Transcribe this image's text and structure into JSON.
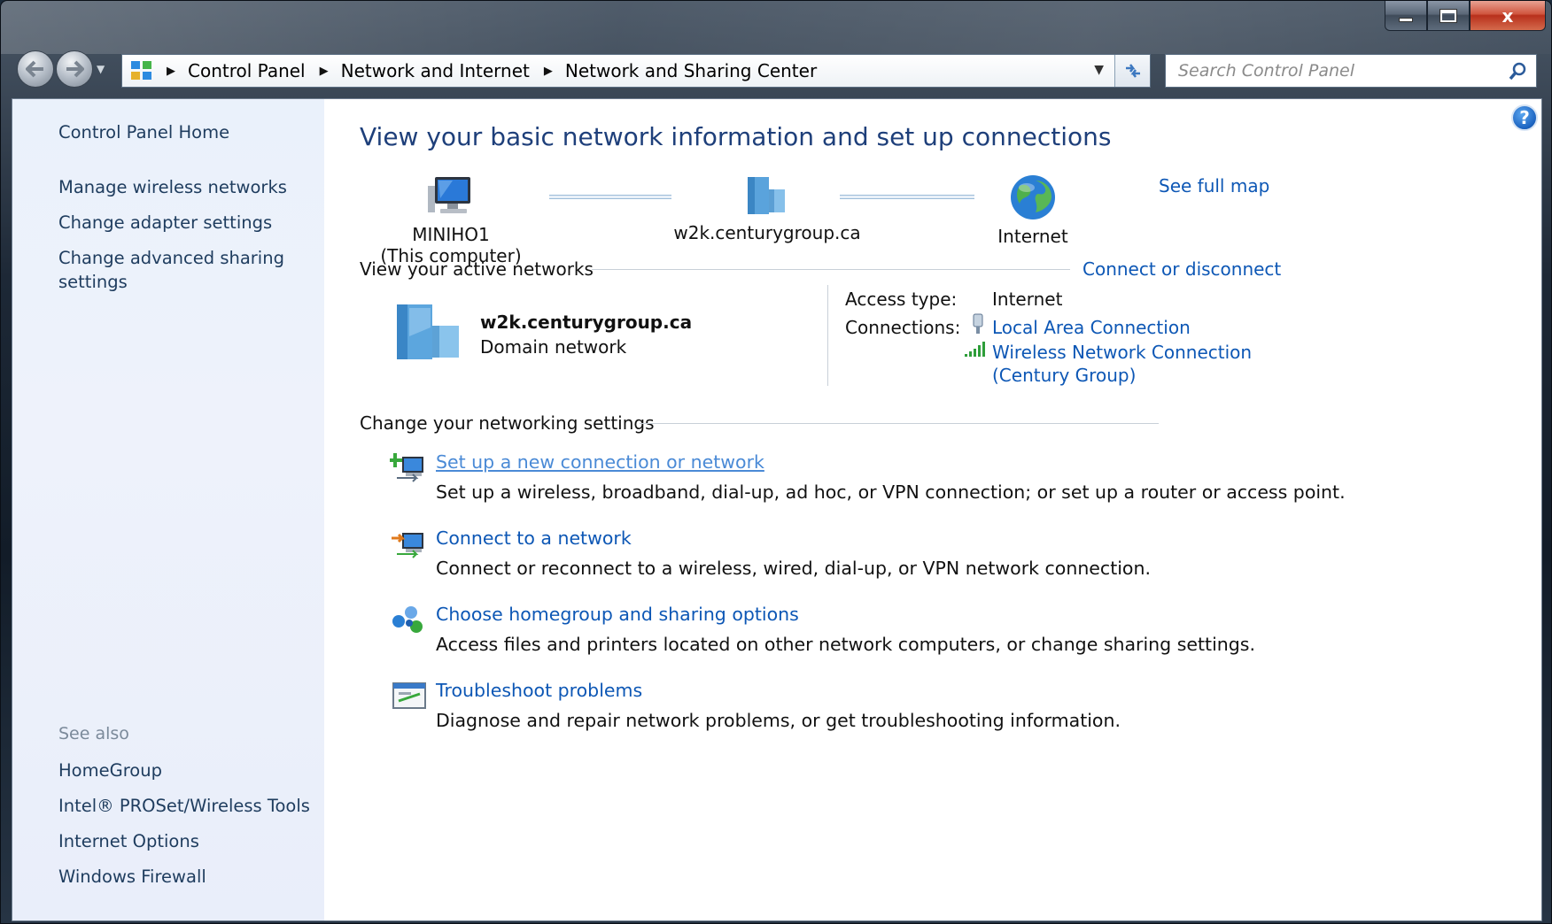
{
  "window": {
    "caption_close_glyph": "x"
  },
  "address_bar": {
    "crumbs": [
      "Control Panel",
      "Network and Internet",
      "Network and Sharing Center"
    ]
  },
  "search": {
    "placeholder": "Search Control Panel"
  },
  "sidebar": {
    "home": "Control Panel Home",
    "tasks": [
      "Manage wireless networks",
      "Change adapter settings",
      "Change advanced sharing settings"
    ],
    "see_also_heading": "See also",
    "see_also": [
      "HomeGroup",
      "Intel® PROSet/Wireless Tools",
      "Internet Options",
      "Windows Firewall"
    ]
  },
  "main": {
    "title": "View your basic network information and set up connections",
    "see_full_map": "See full map",
    "map": {
      "computer_name": "MINIHO1",
      "computer_sub": "(This computer)",
      "domain": "w2k.centurygroup.ca",
      "internet": "Internet"
    },
    "active_networks": {
      "heading": "View your active networks",
      "connect_link": "Connect or disconnect",
      "network_name": "w2k.centurygroup.ca",
      "network_type": "Domain network",
      "access_type_label": "Access type:",
      "access_type_value": "Internet",
      "connections_label": "Connections:",
      "connection_lan": "Local Area Connection",
      "connection_wifi_line1": "Wireless Network Connection",
      "connection_wifi_line2": "(Century Group)"
    },
    "change_settings": {
      "heading": "Change your networking settings",
      "tasks": [
        {
          "title": "Set up a new connection or network",
          "desc": "Set up a wireless, broadband, dial-up, ad hoc, or VPN connection; or set up a router or access point."
        },
        {
          "title": "Connect to a network",
          "desc": "Connect or reconnect to a wireless, wired, dial-up, or VPN network connection."
        },
        {
          "title": "Choose homegroup and sharing options",
          "desc": "Access files and printers located on other network computers, or change sharing settings."
        },
        {
          "title": "Troubleshoot problems",
          "desc": "Diagnose and repair network problems, or get troubleshooting information."
        }
      ]
    }
  },
  "colors": {
    "link": "#0d57b5",
    "title": "#1e3f7a",
    "sidebar_bg": "#eaf1fb"
  }
}
